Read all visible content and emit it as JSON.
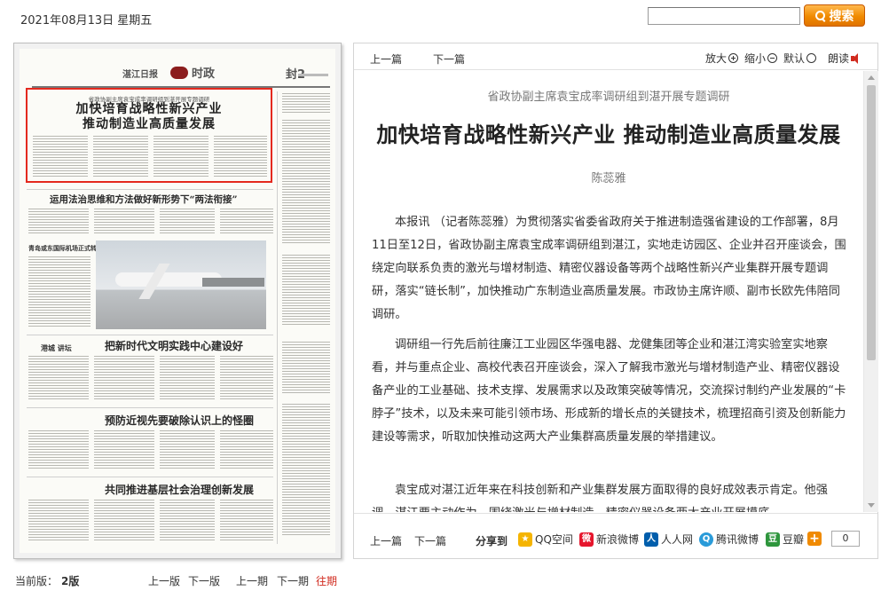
{
  "header": {
    "date": "2021年08月13日 星期五",
    "search_placeholder": "",
    "search_label": "搜索"
  },
  "paper": {
    "masthead_logo": "湛江日报",
    "masthead_section": "时政",
    "masthead_page": "封2",
    "clip_subtitle": "省政协副主席袁宝成率调研组到湛开展专题调研",
    "clip_title_1": "加快培育战略性新兴产业",
    "clip_title_2": "推动制造业高质量发展",
    "headline_2": "运用法治思维和方法做好新形势下“两法衔接”",
    "headline_3": "把新时代文明实践中心建设好",
    "headline_4": "预防近视先要破除认识上的怪圈",
    "headline_5": "共同推进基层社会治理创新发展",
    "photo_caption": "青岛或东国际机场正式转场运营",
    "column_label": "港城 讲坛"
  },
  "paper_footer": {
    "current_label": "当前版：",
    "current_value": "2版",
    "prev_page": "上一版",
    "next_page": "下一版",
    "prev_issue": "上一期",
    "next_issue": "下一期",
    "archive": "往期"
  },
  "article": {
    "nav_prev": "上一篇",
    "nav_next": "下一篇",
    "tool_zoom_in": "放大",
    "tool_zoom_out": "缩小",
    "tool_default": "默认",
    "tool_read": "朗读",
    "subtitle": "省政协副主席袁宝成率调研组到湛开展专题调研",
    "title": "加快培育战略性新兴产业 推动制造业高质量发展",
    "author": "陈蕊雅",
    "paragraphs": [
      "本报讯 （记者陈蕊雅）为贯彻落实省委省政府关于推进制造强省建设的工作部署，8月11日至12日，省政协副主席袁宝成率调研组到湛江，实地走访园区、企业并召开座谈会，围绕定向联系负责的激光与增材制造、精密仪器设备等两个战略性新兴产业集群开展专题调研，落实“链长制”，加快推动广东制造业高质量发展。市政协主席许顺、副市长欧先伟陪同调研。",
      "调研组一行先后前往廉江工业园区华强电器、龙健集团等企业和湛江湾实验室实地察看，并与重点企业、高校代表召开座谈会，深入了解我市激光与增材制造产业、精密仪器设备产业的工业基础、技术支撑、发展需求以及政策突破等情况，交流探讨制约产业发展的“卡脖子”技术，以及未来可能引领市场、形成新的增长点的关键技术，梳理招商引资及创新能力建设等需求，听取加快推动这两大产业集群高质量发展的举措建议。",
      "袁宝成对湛江近年来在科技创新和产业集群发展方面取得的良好成效表示肯定。他强调，湛江要主动作为，围绕激光与增材制造、精密仪器设备两大产业开展摸底"
    ]
  },
  "article_footer": {
    "prev": "上一篇",
    "next": "下一篇",
    "share_label": "分享到",
    "share": [
      {
        "name": "QQ空间",
        "color": "#f5b400",
        "glyph": "★"
      },
      {
        "name": "新浪微博",
        "color": "#e6162d",
        "glyph": "微"
      },
      {
        "name": "人人网",
        "color": "#005eac",
        "glyph": "人"
      },
      {
        "name": "腾讯微博",
        "color": "#2a9bd9",
        "glyph": "Q"
      },
      {
        "name": "豆瓣",
        "color": "#2e963d",
        "glyph": "豆"
      }
    ],
    "more_glyph": "+",
    "count": "0"
  }
}
